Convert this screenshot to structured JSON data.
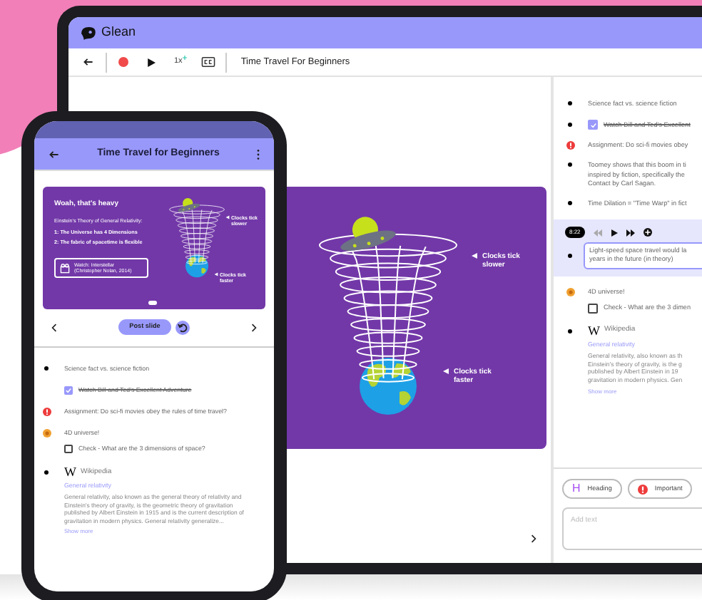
{
  "tablet": {
    "brand": "Glean",
    "toolbar": {
      "recording": true,
      "speed": "1x",
      "title": "Time Travel For Beginners"
    },
    "slide": {
      "labels": [
        "Clocks tick slower",
        "Clocks tick faster"
      ]
    },
    "notes": [
      {
        "kind": "bullet",
        "text": "Science fact vs. science fiction"
      },
      {
        "kind": "todo",
        "bulleted": true,
        "checked": true,
        "text": "Watch Bill and Ted's Excellent"
      },
      {
        "kind": "important",
        "text": "Assignment: Do sci-fi movies obey"
      },
      {
        "kind": "bullet",
        "text": "Toomey shows that this boom in ti\ninspired by fiction, specifically the\nContact by Carl Sagan."
      },
      {
        "kind": "bullet",
        "text": "Time Dilation = \"Time Warp\" in fict"
      },
      {
        "kind": "clip",
        "selected": true,
        "time": "8:22",
        "text": "Light-speed space travel would la\nyears in the future (in theory)"
      },
      {
        "kind": "topic",
        "text": "4D universe!",
        "children": [
          {
            "kind": "todo",
            "bulleted": false,
            "checked": false,
            "text": "Check - What are the 3 dimen"
          }
        ]
      },
      {
        "kind": "wiki",
        "logo": "W",
        "source": "Wikipedia",
        "link": "General relativity",
        "text": "General relativity, also known as th\nEinstein's theory of gravity, is the g\npublished by Albert Einstein in 19\ngravitation in modern physics. Gen",
        "more": "Show more"
      }
    ],
    "note_tools": [
      {
        "kind": "heading",
        "glyph": "H",
        "label": "Heading"
      },
      {
        "kind": "important",
        "label": "Important"
      }
    ],
    "note_input": {
      "placeholder": "Add text"
    }
  },
  "phone": {
    "title": "Time Travel for Beginners",
    "slide": {
      "title": "Woah, that's heavy",
      "subtitle": "Einstein's Theory of General Relativity:",
      "points": [
        "1: The Universe has 4 Dimensions",
        "2: The fabric of spacetime is flexible"
      ],
      "watch": "Watch: Interstellar (Christopher Nolan, 2014)",
      "labels": [
        "Clocks tick slower",
        "Clocks tick faster"
      ]
    },
    "post_button": "Post slide",
    "notes": [
      {
        "kind": "bullet",
        "text": "Science fact vs. science fiction"
      },
      {
        "kind": "todo",
        "bulleted": false,
        "checked": true,
        "text": "Watch Bill and Ted's Excellent Adventure"
      },
      {
        "kind": "important",
        "text": "Assignment: Do sci-fi movies obey the rules of time travel?"
      },
      {
        "kind": "topic",
        "text": "4D universe!",
        "children": [
          {
            "kind": "todo",
            "bulleted": false,
            "checked": false,
            "text": "Check - What are the 3 dimensions of space?"
          }
        ]
      },
      {
        "kind": "wiki",
        "logo": "W",
        "source": "Wikipedia",
        "link": "General relativity",
        "text": "General relativity, also known as the general theory of relativity and Einstein's theory of gravity, is the geometric theory of gravitation published by Albert Einstein in 1915 and is the current description of gravitation in modern physics. General relativity generalize...",
        "more": "Show more"
      }
    ]
  }
}
